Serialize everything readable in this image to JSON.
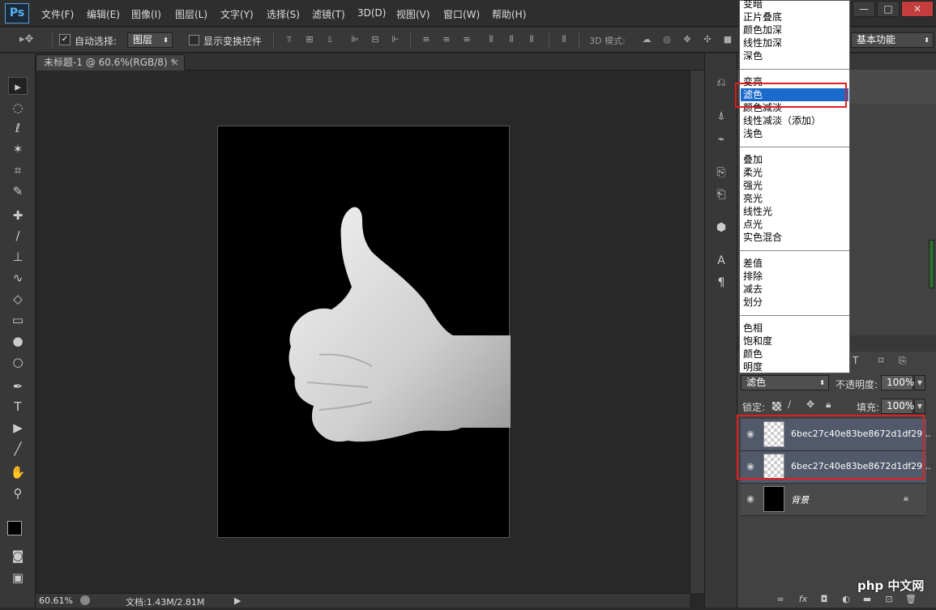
{
  "app": {
    "logo": "Ps"
  },
  "menu": [
    "文件(F)",
    "编辑(E)",
    "图像(I)",
    "图层(L)",
    "文字(Y)",
    "选择(S)",
    "滤镜(T)",
    "3D(D)",
    "视图(V)",
    "窗口(W)",
    "帮助(H)"
  ],
  "options": {
    "auto_select_label": "自动选择:",
    "auto_select_value": "图层",
    "show_transform_label": "显示变换控件",
    "mode_3d_label": "3D 模式:",
    "workspace_value": "基本功能"
  },
  "document": {
    "tab_title": "未标题-1 @ 60.6%(RGB/8) *"
  },
  "status": {
    "zoom": "60.61%",
    "doc_info": "文档:1.43M/2.81M"
  },
  "blend_dropdown": {
    "items": [
      "变暗",
      "正片叠底",
      "颜色加深",
      "线性加深",
      "深色",
      "变亮",
      "滤色",
      "颜色减淡",
      "线性减淡（添加）",
      "浅色",
      "叠加",
      "柔光",
      "强光",
      "亮光",
      "线性光",
      "点光",
      "实色混合",
      "差值",
      "排除",
      "减去",
      "划分",
      "色相",
      "饱和度",
      "颜色",
      "明度"
    ],
    "selected": "滤色"
  },
  "layers_panel": {
    "blend_mode": "滤色",
    "opacity_label": "不透明度:",
    "opacity_value": "100%",
    "lock_label": "锁定:",
    "fill_label": "填充:",
    "fill_value": "100%",
    "layers": [
      {
        "name": "6bec27c40e83be8672d1df29...",
        "selected": true
      },
      {
        "name": "6bec27c40e83be8672d1df29...",
        "selected": true
      },
      {
        "name": "背景",
        "selected": false
      }
    ]
  },
  "watermark": "php 中文网",
  "colors": {
    "selection_blue": "#1b6bcc",
    "highlight_red": "#e02020",
    "layer_selected": "#51596b"
  }
}
